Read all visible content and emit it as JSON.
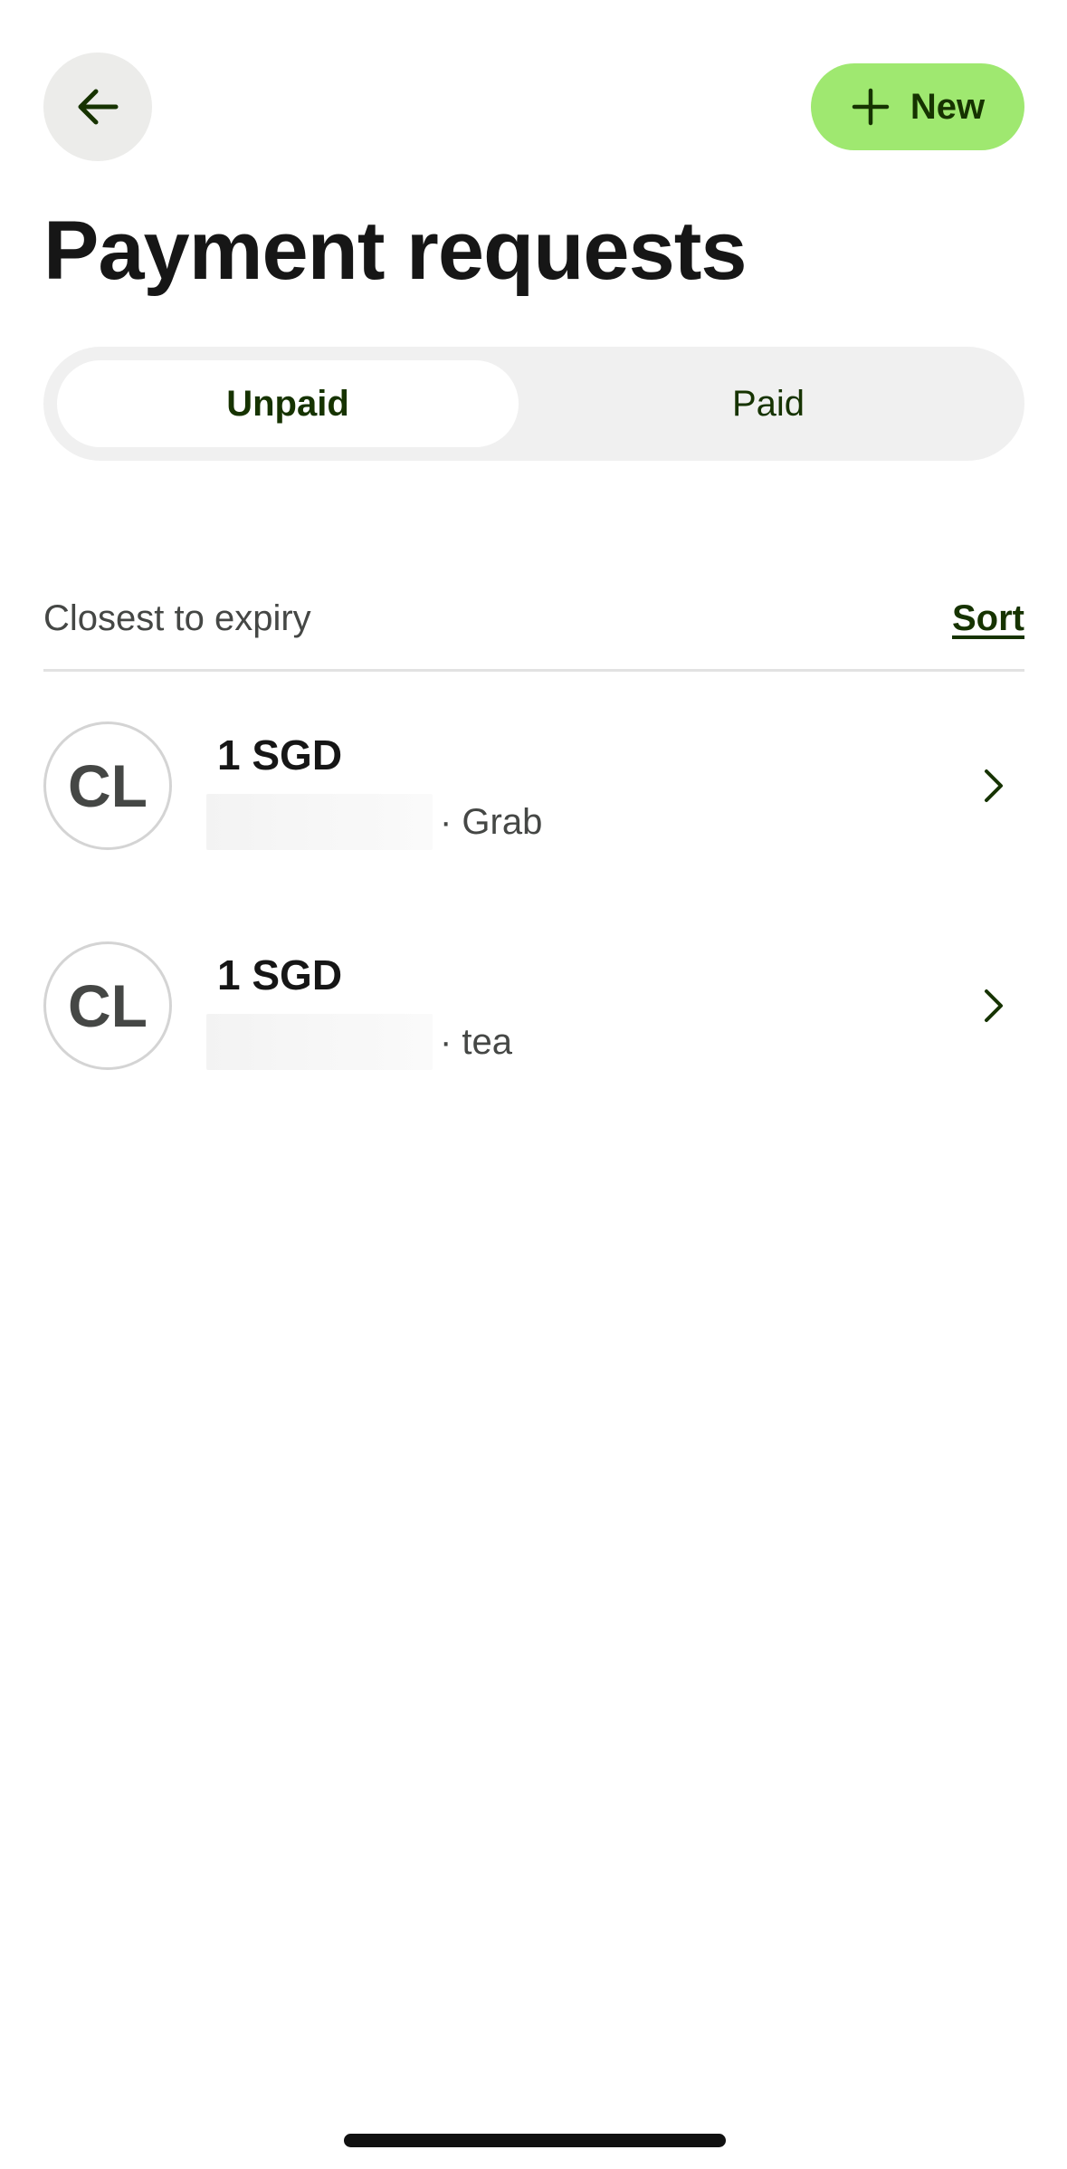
{
  "header": {
    "back_icon": "arrow-left-icon",
    "new_button": {
      "icon": "plus-icon",
      "label": "New"
    },
    "title": "Payment requests"
  },
  "tabs": [
    {
      "label": "Unpaid",
      "active": true
    },
    {
      "label": "Paid",
      "active": false
    }
  ],
  "sort": {
    "label": "Closest to expiry",
    "link": "Sort"
  },
  "requests": [
    {
      "avatar_initials": "CL",
      "amount": "1 SGD",
      "detail": "· Grab",
      "icon": "chevron-right-icon"
    },
    {
      "avatar_initials": "CL",
      "amount": "1 SGD",
      "detail": "· tea",
      "icon": "chevron-right-icon"
    }
  ],
  "colors": {
    "accent": "#9fe870",
    "accent_text": "#163300",
    "back_bg": "#ececea",
    "tabs_bg": "#f0f0f0"
  }
}
